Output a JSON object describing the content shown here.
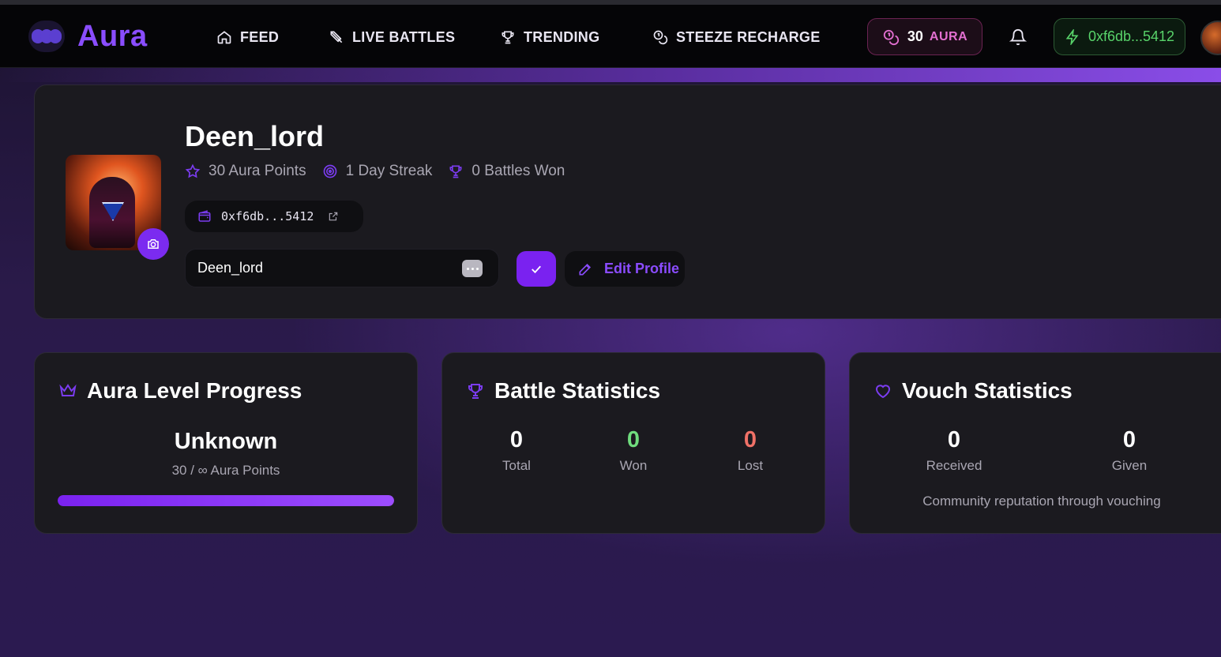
{
  "brand": {
    "name": "Aura",
    "color": "#8a4dff"
  },
  "nav": {
    "items": [
      {
        "label": "FEED",
        "icon": "home-icon"
      },
      {
        "label": "LIVE BATTLES",
        "icon": "swords-icon"
      },
      {
        "label": "TRENDING",
        "icon": "trophy-icon"
      },
      {
        "label": "STEEZE RECHARGE",
        "icon": "coins-icon"
      }
    ],
    "aura_balance": {
      "value": "30",
      "label": "AURA"
    },
    "wallet": "0xf6db...5412"
  },
  "profile": {
    "username": "Deen_lord",
    "aura_points": "30 Aura Points",
    "streak": "1 Day Streak",
    "battles_won": "0 Battles Won",
    "address": "0xf6db...5412",
    "name_input_value": "Deen_lord",
    "edit_label": "Edit Profile"
  },
  "level_card": {
    "title": "Aura Level Progress",
    "level": "Unknown",
    "points_text": "30 / ∞ Aura Points",
    "progress": 1.0
  },
  "battle_card": {
    "title": "Battle Statistics",
    "stats": [
      {
        "value": "0",
        "label": "Total",
        "color": "#ffffff"
      },
      {
        "value": "0",
        "label": "Won",
        "color": "#6fdc7d"
      },
      {
        "value": "0",
        "label": "Lost",
        "color": "#f07167"
      }
    ]
  },
  "vouch_card": {
    "title": "Vouch Statistics",
    "received": {
      "value": "0",
      "label": "Received"
    },
    "given": {
      "value": "0",
      "label": "Given"
    },
    "note": "Community reputation through vouching"
  }
}
